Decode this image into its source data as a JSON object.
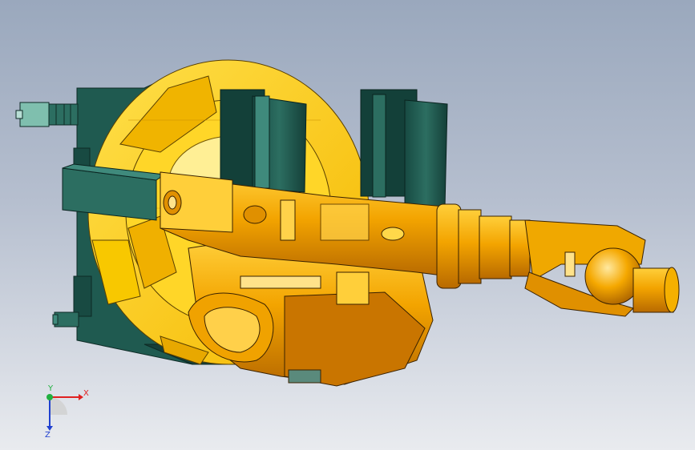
{
  "viewport": {
    "background_top": "#9aa8bd",
    "background_bottom": "#e9ebef"
  },
  "model": {
    "colors": {
      "yellow": "#ffd11a",
      "yellow_dark": "#e0a800",
      "orange": "#f2a300",
      "orange_dark": "#c87300",
      "teal": "#1f5a50",
      "teal_light": "#3f8a7c",
      "teal_pale": "#7fbfae",
      "outline": "#1a1a1a"
    }
  },
  "triad": {
    "x_label": "X",
    "y_label": "Y",
    "z_label": "Z",
    "x_color": "#e02020",
    "y_color": "#20b040",
    "z_color": "#2040d0"
  }
}
